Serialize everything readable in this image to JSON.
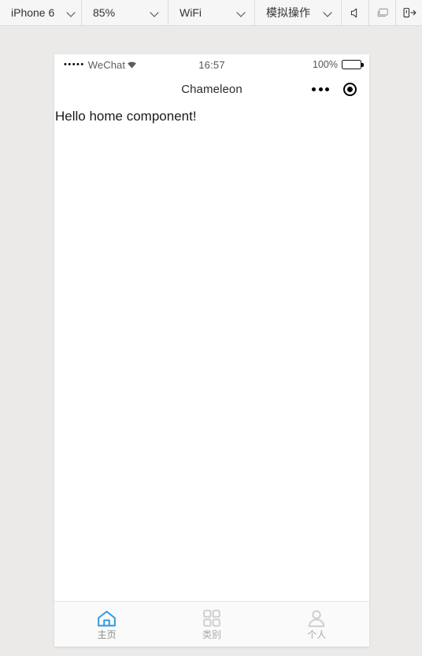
{
  "toolbar": {
    "device": {
      "label": "iPhone 6",
      "icon": "chevron-down-icon"
    },
    "zoom": {
      "label": "85%",
      "icon": "chevron-down-icon"
    },
    "network": {
      "label": "WiFi",
      "icon": "chevron-down-icon"
    },
    "simulate": {
      "label": "模拟操作",
      "icon": "chevron-down-icon"
    },
    "icons": [
      {
        "name": "speaker-icon"
      },
      {
        "name": "display-icon"
      },
      {
        "name": "rotate-device-icon"
      }
    ]
  },
  "phone": {
    "statusbar": {
      "signal_dots": "•••••",
      "carrier": "WeChat",
      "wifi_icon": "wifi-icon",
      "time": "16:57",
      "battery_percent": "100%",
      "battery_icon": "battery-full-icon"
    },
    "navbar": {
      "title": "Chameleon",
      "menu_icon": "more-dots-icon",
      "target_icon": "target-circle-icon"
    },
    "content": {
      "text": "Hello home component!"
    },
    "tabbar": {
      "active_color": "#2f9ae0",
      "inactive_color": "#cfcfcf",
      "items": [
        {
          "label": "主页",
          "icon": "home-icon",
          "active": true
        },
        {
          "label": "类别",
          "icon": "grid-icon",
          "active": false
        },
        {
          "label": "个人",
          "icon": "person-icon",
          "active": false
        }
      ]
    }
  }
}
